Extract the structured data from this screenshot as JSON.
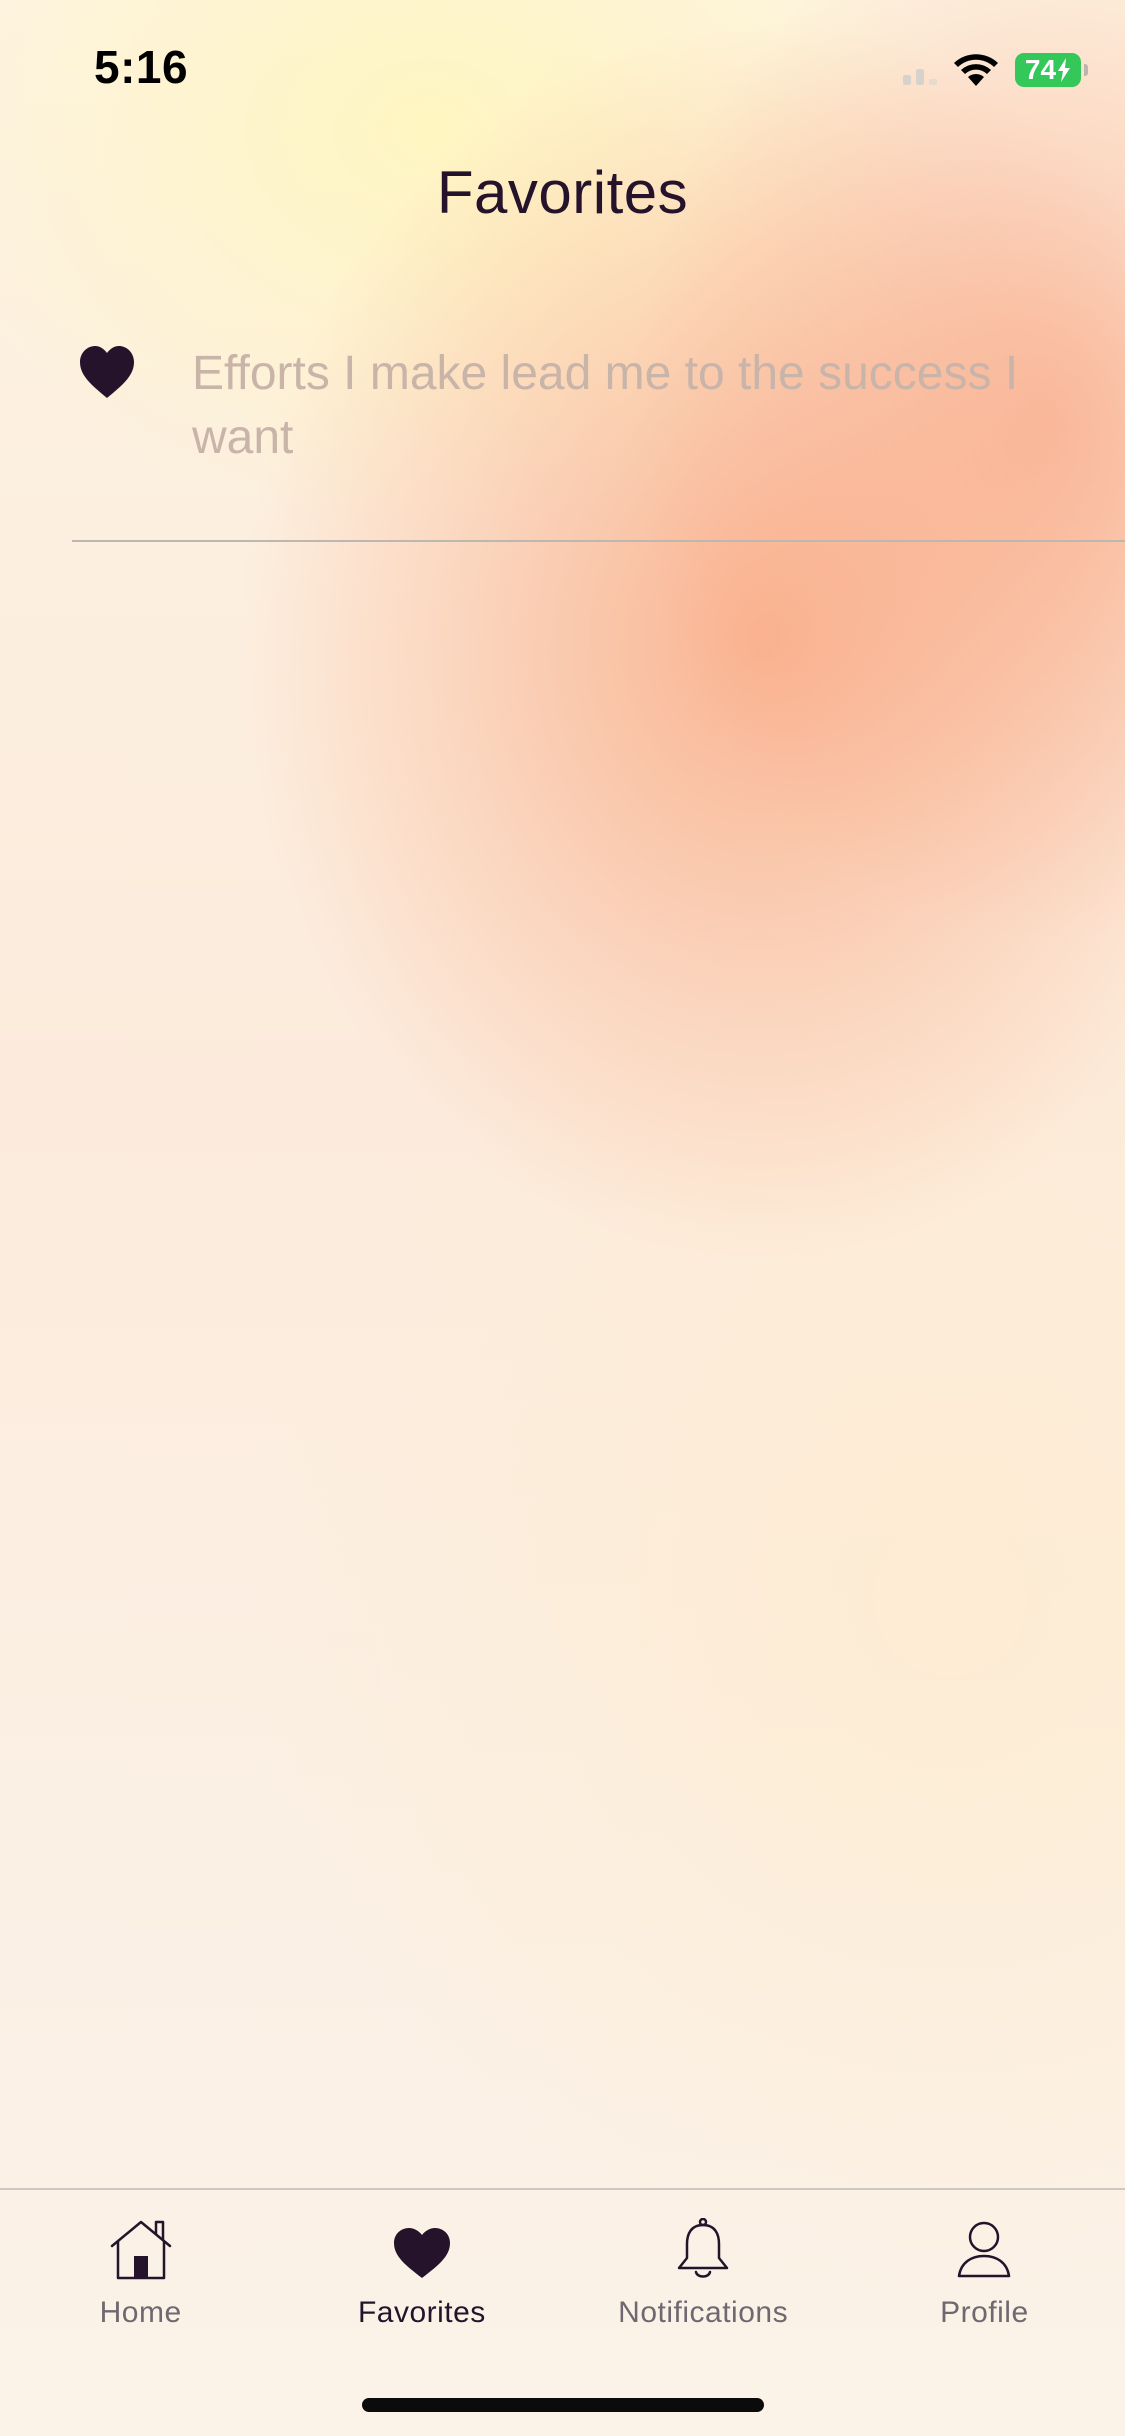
{
  "status_bar": {
    "time": "5:16",
    "battery_level": "74",
    "battery_color": "#34c759",
    "icons": [
      "signal-icon",
      "wifi-icon",
      "battery-charging-icon"
    ]
  },
  "header": {
    "title": "Favorites"
  },
  "favorites": [
    {
      "icon": "heart-filled-icon",
      "text": "Efforts I make lead me to the success I want"
    }
  ],
  "tab_bar": {
    "active": "Favorites",
    "tabs": [
      {
        "label": "Home",
        "icon": "home-icon"
      },
      {
        "label": "Favorites",
        "icon": "heart-filled-icon"
      },
      {
        "label": "Notifications",
        "icon": "bell-icon"
      },
      {
        "label": "Profile",
        "icon": "person-icon"
      }
    ]
  },
  "colors": {
    "primary_text": "#25132b",
    "muted_text": "#c9b4aa",
    "inactive_tab": "#6f6870"
  }
}
